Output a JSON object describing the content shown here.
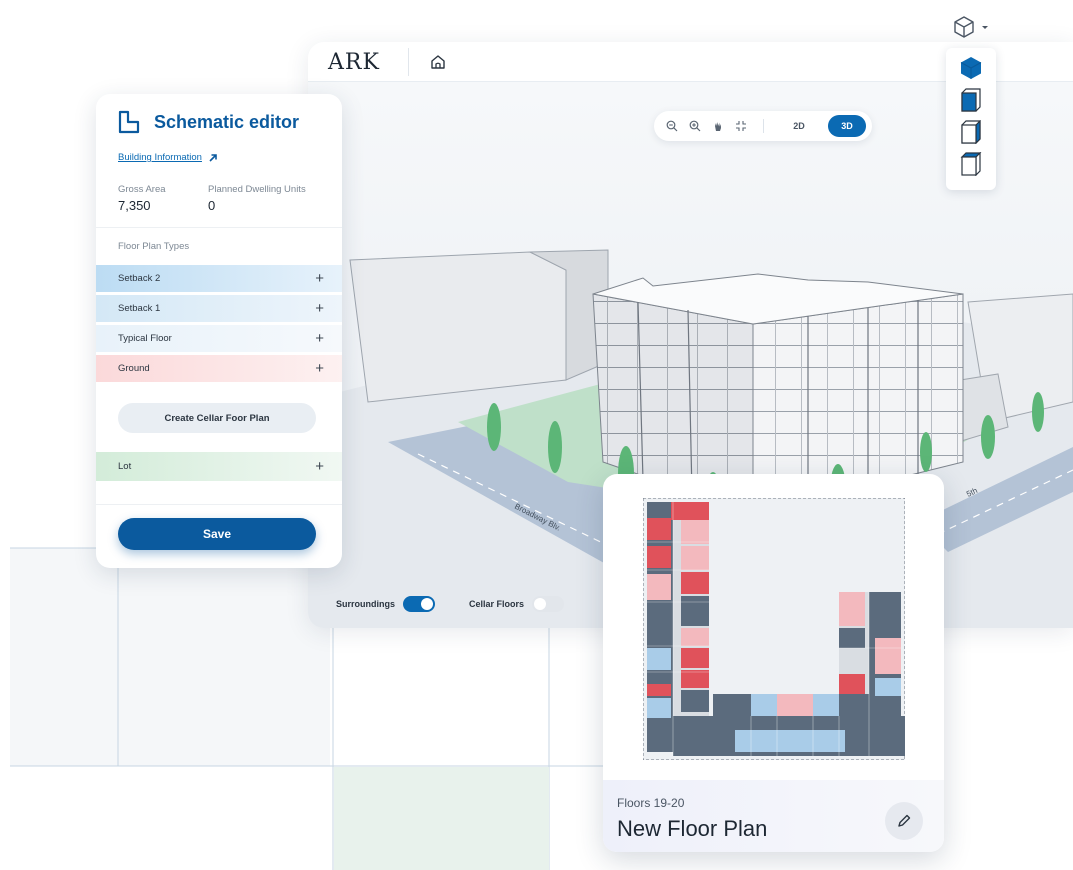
{
  "app": {
    "logo": "ARK"
  },
  "toolbar": {
    "icons": [
      "zoom-out-icon",
      "zoom-in-icon",
      "pan-hand-icon",
      "fit-view-icon"
    ],
    "mode_2d": "2D",
    "mode_3d": "3D",
    "active_mode": "3D"
  },
  "view_cube": {
    "trigger_icon": "cube-outline-icon",
    "options": [
      "cube-iso-icon",
      "cube-front-icon",
      "cube-side-icon",
      "cube-top-icon"
    ]
  },
  "scene": {
    "street_labels": [
      "Broadway Blv.",
      "5th"
    ]
  },
  "toggles": {
    "surroundings_label": "Surroundings",
    "surroundings_on": true,
    "cellar_label": "Cellar Floors",
    "cellar_on": false
  },
  "panel": {
    "title": "Schematic editor",
    "building_info_link": "Building Information",
    "gross_area_label": "Gross Area",
    "gross_area_value": "7,350",
    "dwelling_label": "Planned Dwelling Units",
    "dwelling_value": "0",
    "floor_plan_types_label": "Floor Plan Types",
    "floor_plans": [
      {
        "label": "Setback 2",
        "color": "#cfe6f7"
      },
      {
        "label": "Setback 1",
        "color": "#e3f0f9"
      },
      {
        "label": "Typical Floor",
        "color": "#f0f6fb"
      },
      {
        "label": "Ground",
        "color": "#fce7e7"
      }
    ],
    "cellar_button": "Create Cellar Foor Plan",
    "lot_label": "Lot",
    "lot_color": "#e3f2e6",
    "save_button": "Save"
  },
  "card": {
    "floors": "Floors 19-20",
    "title": "New Floor Plan"
  },
  "colors": {
    "accent": "#0b6ab3",
    "title_blue": "#0b5a9e",
    "unit_red": "#e0525b",
    "unit_pink": "#f3b9be",
    "unit_slate": "#5b6b7d",
    "unit_light_blue": "#a9cce8",
    "tree_green": "#5cb677"
  }
}
